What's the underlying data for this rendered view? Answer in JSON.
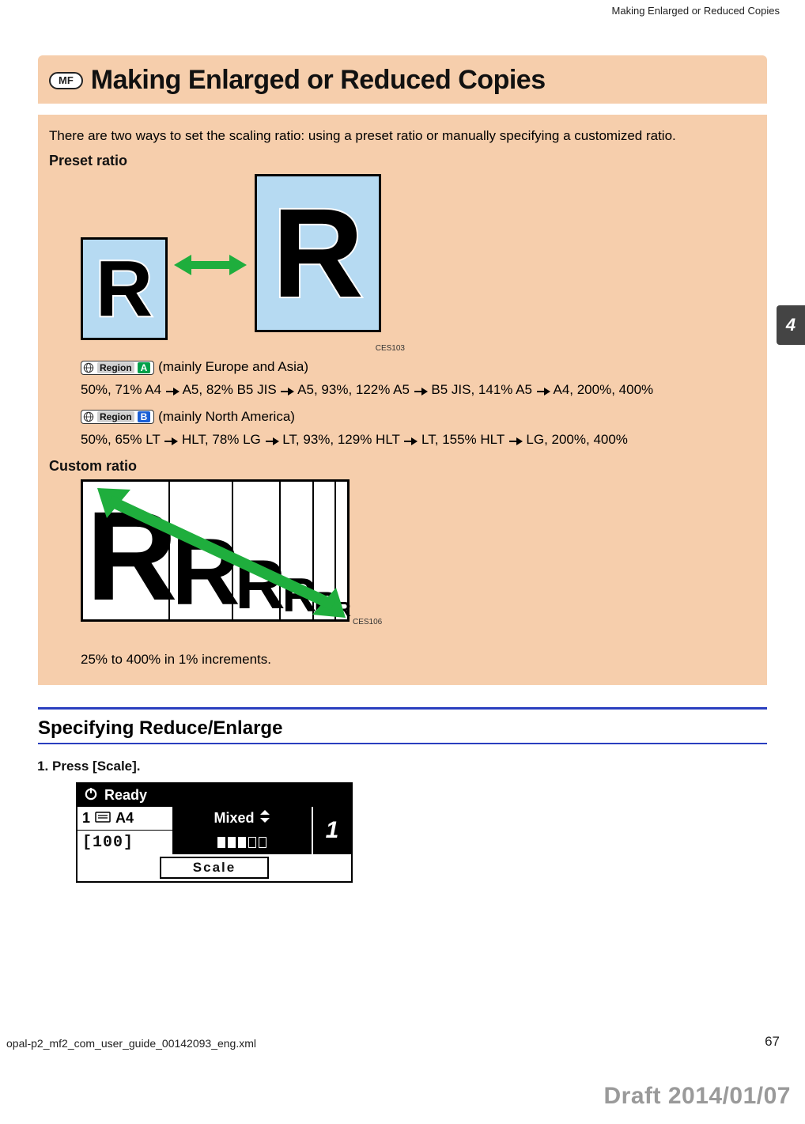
{
  "running_head": "Making Enlarged or Reduced Copies",
  "side_tab": "4",
  "title": {
    "mf_badge": "MF",
    "text": "Making Enlarged or Reduced Copies"
  },
  "intro": "There are two ways to set the scaling ratio: using a preset ratio or manually specifying a customized ratio.",
  "preset": {
    "heading": "Preset ratio",
    "fig_caption": "CES103",
    "letter": "R",
    "region_a": {
      "badge_label": "Region",
      "badge_letter": "A",
      "note": "(mainly Europe and Asia)",
      "ratios": {
        "p1": "50%, 71% A4 ",
        "p2": " A5, 82% B5 JIS ",
        "p3": " A5, 93%, 122% A5 ",
        "p4": " B5 JIS, 141% A5 ",
        "p5": " A4, 200%, 400%"
      }
    },
    "region_b": {
      "badge_label": "Region",
      "badge_letter": "B",
      "note": " (mainly North America)",
      "ratios": {
        "p1": "50%, 65% LT ",
        "p2": " HLT, 78% LG ",
        "p3": " LT, 93%, 129% HLT ",
        "p4": " LT, 155% HLT ",
        "p5": " LG, 200%, 400%"
      }
    }
  },
  "custom": {
    "heading": "Custom ratio",
    "fig_caption": "CES106",
    "letter": "R",
    "note": "25% to 400% in 1% increments."
  },
  "section": {
    "title": "Specifying Reduce/Enlarge"
  },
  "steps": {
    "s1": "Press [Scale]."
  },
  "lcd": {
    "status": "Ready",
    "tray": "1",
    "paper": "A4",
    "orig": "Mixed",
    "copies": "1",
    "zoom": "[100]",
    "scale_btn": "Scale"
  },
  "footer": {
    "file": "opal-p2_mf2_com_user_guide_00142093_eng.xml",
    "page": "67",
    "draft": "Draft 2014/01/07"
  }
}
